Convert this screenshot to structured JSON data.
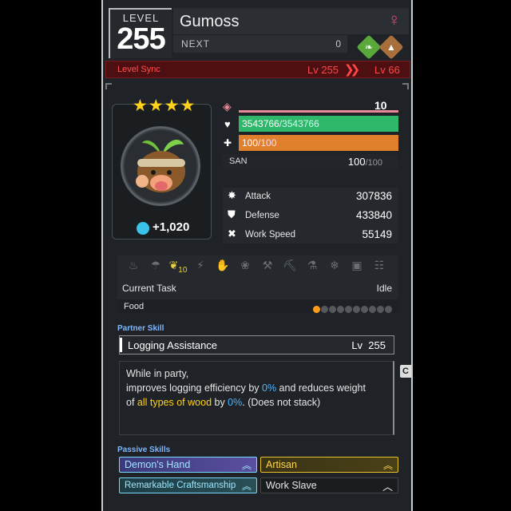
{
  "header": {
    "level_label": "LEVEL",
    "level_value": "255",
    "pal_name": "Gumoss",
    "gender_symbol": "♀",
    "next_label": "NEXT",
    "next_value": "0",
    "elements": [
      {
        "name": "grass-element-icon",
        "color": "#5aa83c"
      },
      {
        "name": "ground-element-icon",
        "color": "#a86f3c"
      }
    ]
  },
  "level_sync": {
    "label": "Level Sync",
    "from_level": "Lv 255",
    "to_level": "Lv 66"
  },
  "portrait": {
    "stars": "★★★★",
    "friendship": "+1,020"
  },
  "stats": {
    "rank_value": "10",
    "hp_current": "3543766",
    "hp_max": "/3543766",
    "hunger_current": "100",
    "hunger_max": "/100",
    "san_label": "SAN",
    "san_current": "100",
    "san_max": "/100",
    "attack_label": "Attack",
    "attack_value": "307836",
    "defense_label": "Defense",
    "defense_value": "433840",
    "work_speed_label": "Work Speed",
    "work_speed_value": "55149",
    "hp_fraction": 1.0,
    "hunger_fraction": 1.0,
    "colors": {
      "hp": "#2fb86a",
      "hunger": "#e07f2c",
      "rank": "#e8899a"
    }
  },
  "work": {
    "active_suitability_level": "10",
    "current_task_label": "Current Task",
    "current_task_value": "Idle",
    "food_label": "Food",
    "food_filled": 1,
    "food_total": 10
  },
  "partner_skill": {
    "section_label": "Partner Skill",
    "name": "Logging Assistance",
    "level_prefix": "Lv",
    "level": "255",
    "desc_line1": "While in party,",
    "desc_line2a": "improves logging efficiency by ",
    "desc_line2b": "0%",
    "desc_line2c": " and reduces weight",
    "desc_line3a": "of ",
    "desc_line3b": "all types of wood",
    "desc_line3c": " by ",
    "desc_line3d": "0%",
    "desc_line3e": ". (Does not stack)",
    "side_tab": "C"
  },
  "passive_skills": {
    "section_label": "Passive Skills",
    "items": [
      {
        "name": "Demon's Hand",
        "tier": "legendary"
      },
      {
        "name": "Artisan",
        "tier": "gold"
      },
      {
        "name": "Remarkable Craftsmanship",
        "tier": "legendary"
      },
      {
        "name": "Work Slave",
        "tier": "negative"
      }
    ]
  }
}
